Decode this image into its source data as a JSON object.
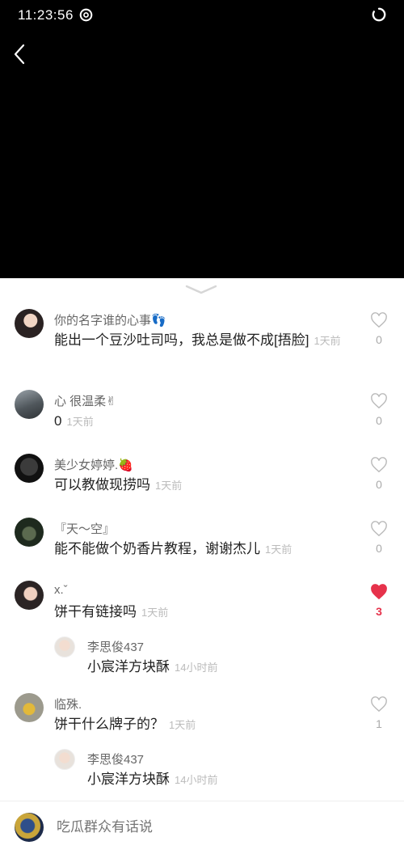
{
  "status_bar": {
    "time": "11:23:56"
  },
  "comment_input": {
    "placeholder": "吃瓜群众有话说"
  },
  "comments": [
    {
      "username": "你的名字谁的心事👣",
      "text": "能出一个豆沙吐司吗，我总是做不成[捂脸]",
      "time": "1天前",
      "likes": "0",
      "liked": false
    },
    {
      "username": "心 很温柔✌",
      "text": "0",
      "time": "1天前",
      "likes": "0",
      "liked": false
    },
    {
      "username": "美少女婷婷.🍓",
      "text": "可以教做现捞吗",
      "time": "1天前",
      "likes": "0",
      "liked": false
    },
    {
      "username": "『天～空』",
      "text": "能不能做个奶香片教程，谢谢杰儿",
      "time": "1天前",
      "likes": "0",
      "liked": false
    },
    {
      "username": "x.ˇ",
      "text": "饼干有链接吗",
      "time": "1天前",
      "likes": "3",
      "liked": true,
      "reply": {
        "username": "李思俊437",
        "text": "小宸洋方块酥",
        "time": "14小时前"
      }
    },
    {
      "username": "临殊.",
      "text": "饼干什么牌子的？",
      "time": "1天前",
      "likes": "1",
      "liked": false,
      "reply": {
        "username": "李思俊437",
        "text": "小宸洋方块酥",
        "time": "14小时前"
      }
    }
  ],
  "colors": {
    "accent_like": "#e6324b",
    "sheet_bg": "#ffffff",
    "video_bg": "#000000"
  },
  "icons": [
    "back-icon",
    "heart-outline-icon",
    "heart-filled-icon",
    "collapse-chevron-icon",
    "loading-icon"
  ]
}
